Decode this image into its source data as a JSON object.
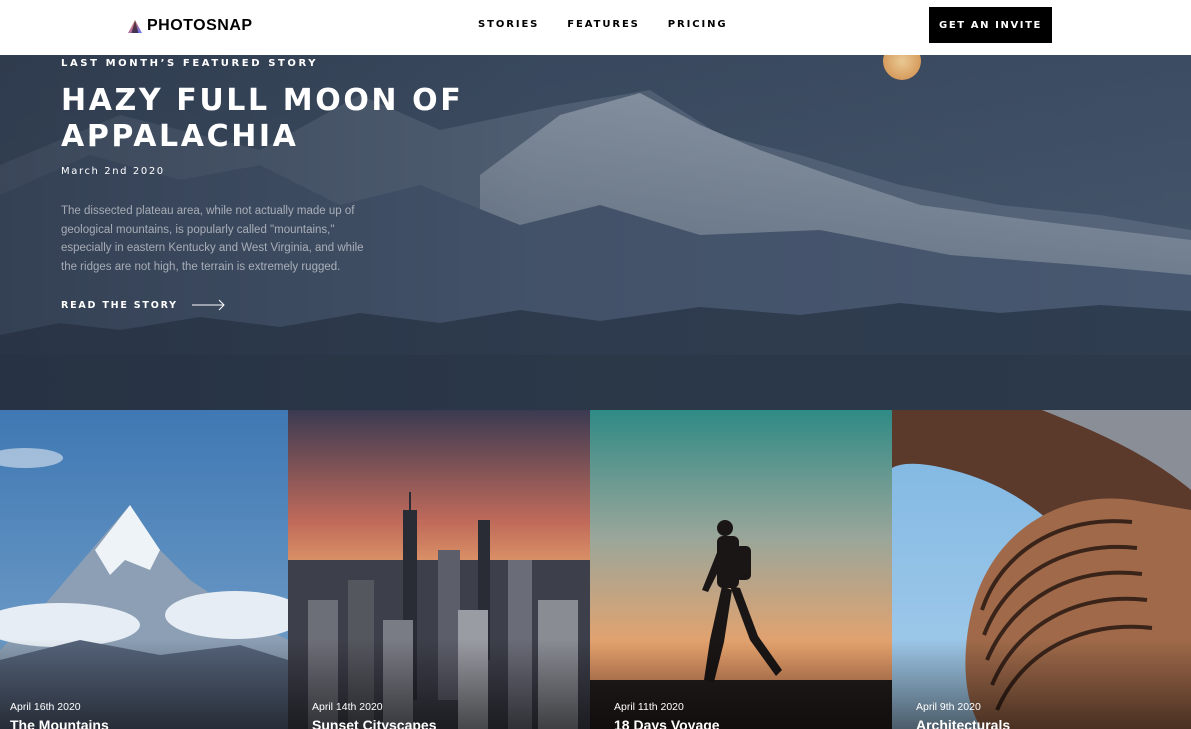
{
  "header": {
    "logo_text": "PHOTOSNAP",
    "nav": [
      "STORIES",
      "FEATURES",
      "PRICING"
    ],
    "cta_label": "GET AN INVITE"
  },
  "hero": {
    "eyebrow": "LAST MONTH’S FEATURED STORY",
    "title_line1": "HAZY FULL MOON OF",
    "title_line2": "APPALACHIA",
    "date": "March 2nd 2020",
    "description": "The dissected plateau area, while not actually made up of geological mountains, is popularly called \"mountains,\" especially in eastern Kentucky and West Virginia, and while the ridges are not high, the terrain is extremely rugged.",
    "link_label": "READ THE STORY"
  },
  "cards": [
    {
      "date": "April 16th 2020",
      "title": "The Mountains",
      "scene": "snowy-peak-photo"
    },
    {
      "date": "April 14th 2020",
      "title": "Sunset Cityscapes",
      "scene": "city-skyline-photo"
    },
    {
      "date": "April 11th 2020",
      "title": "18 Days Voyage",
      "scene": "hiker-silhouette-photo"
    },
    {
      "date": "April 9th 2020",
      "title": "Architecturals",
      "scene": "curved-building-photo"
    }
  ],
  "colors": {
    "brand_black": "#000000",
    "hero_overlay": "#2a3648",
    "logo_gradient": [
      "#ffc593",
      "#bc7198",
      "#5a77ff"
    ]
  }
}
